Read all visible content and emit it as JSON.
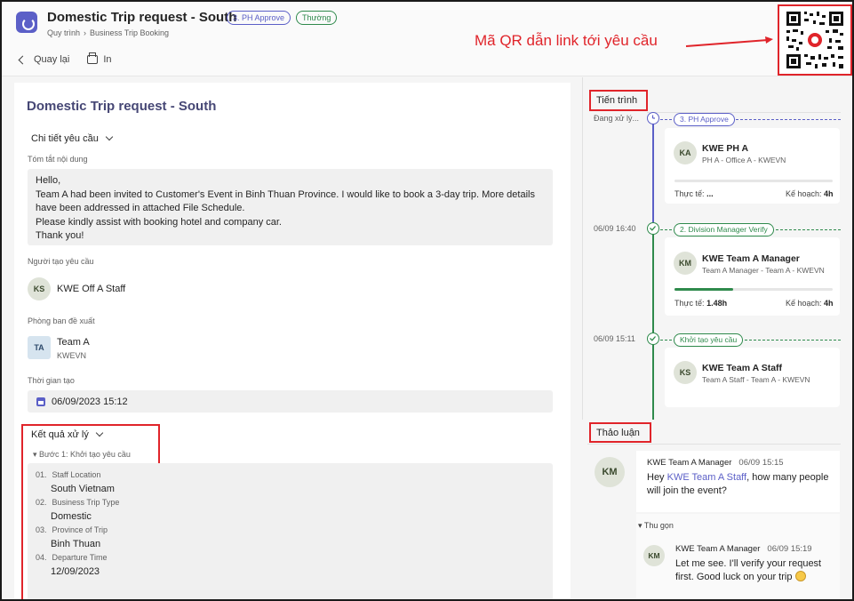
{
  "header": {
    "title": "Domestic Trip request - South",
    "phase_badge": "3. PH Approve",
    "priority_badge": "Thường",
    "breadcrumb": [
      "Quy trình",
      "Business Trip Booking"
    ],
    "back_label": "Quay lại",
    "print_label": "In"
  },
  "annotation": {
    "qr_note": "Mã QR dẫn link tới yêu cầu",
    "accent": "#e0242a"
  },
  "form": {
    "title": "Domestic Trip request - South",
    "details_section": "Chi tiết yêu cầu",
    "summary_label": "Tóm tắt nội dung",
    "summary_lines": [
      "Hello,",
      "Team A had been invited to Customer's Event in Binh Thuan Province. I would like to book a 3-day trip. More details",
      "have been addressed in attached File Schedule.",
      "Please kindly assist with booking hotel and company car.",
      "Thank you!"
    ],
    "creator_label": "Người tạo yêu cầu",
    "creator_initials": "KS",
    "creator_name": "KWE Off A Staff",
    "dept_label": "Phòng ban đề xuất",
    "dept_initials": "TA",
    "dept_name": "Team A",
    "dept_sub": "KWEVN",
    "created_label": "Thời gian tạo",
    "created_value": "06/09/2023 15:12",
    "result_section": "Kết quả xử lý",
    "step_label": "Bước 1: Khởi tạo yêu cầu",
    "results": [
      {
        "num": "01.",
        "label": "Staff Location",
        "value": "South Vietnam"
      },
      {
        "num": "02.",
        "label": "Business Trip Type",
        "value": "Domestic"
      },
      {
        "num": "03.",
        "label": "Province of Trip",
        "value": "Binh Thuan"
      },
      {
        "num": "04.",
        "label": "Departure Time",
        "value": "12/09/2023"
      }
    ]
  },
  "timeline": {
    "title": "Tiến trình",
    "steps": [
      {
        "time": "Đang xử lý...",
        "pill": "3. PH Approve",
        "initials": "KA",
        "name": "KWE PH A",
        "sub": "PH A - Office A - KWEVN",
        "actual_label": "Thực tế:",
        "actual": "...",
        "plan_label": "Kế hoạch:",
        "plan": "4h",
        "progress": 0.0
      },
      {
        "time": "06/09 16:40",
        "pill": "2. Division Manager Verify",
        "initials": "KM",
        "name": "KWE Team A Manager",
        "sub": "Team A Manager - Team A - KWEVN",
        "actual_label": "Thực tế:",
        "actual": "1.48h",
        "plan_label": "Kế hoạch:",
        "plan": "4h",
        "progress": 0.37
      },
      {
        "time": "06/09 15:11",
        "pill": "Khởi tạo yêu cầu",
        "initials": "KS",
        "name": "KWE Team A Staff",
        "sub": "Team A Staff - Team A - KWEVN"
      }
    ],
    "colors": {
      "pending": "#5b5fc7",
      "done": "#2f8a4c"
    }
  },
  "discussion": {
    "title": "Thảo luận",
    "collapse_label": "Thu gọn",
    "messages": [
      {
        "initials": "KM",
        "author": "KWE Team A Manager",
        "time": "06/09 15:15",
        "text_before": "Hey ",
        "mention": "KWE Team A Staff",
        "text_after": ", how many people will join the event?"
      },
      {
        "initials": "KM",
        "author": "KWE Team A Manager",
        "time": "06/09 15:19",
        "text": "Let me see. I'll verify your request first. Good luck on your trip"
      }
    ]
  }
}
